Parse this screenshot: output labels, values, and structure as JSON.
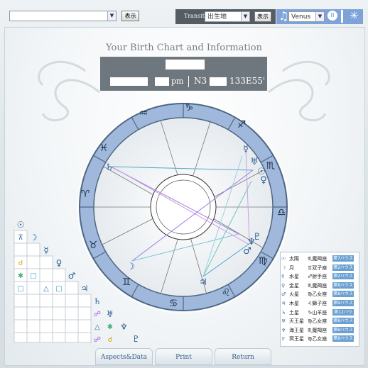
{
  "header": {
    "transit_label": "Transit",
    "transit_select": "出生地",
    "display_button": "表示",
    "display_button_2": "表示",
    "planet_select": "Venus"
  },
  "title": "Your Birth Chart and Information",
  "info": {
    "time_suffix": "pm",
    "coords": "N3",
    "longitude": "133E55'"
  },
  "colors": {
    "accent": "#7ea3d8",
    "header_dark": "#555d63",
    "info_box": "#6f777e",
    "house_tag": "#6aa0d2"
  },
  "planet_table": [
    {
      "symbol": "☉",
      "name": "太陽",
      "sign": "♏魔羯座",
      "house": "第7ハウス"
    },
    {
      "symbol": "☽",
      "name": "月",
      "sign": "♊双子座",
      "house": "第2ハウス"
    },
    {
      "symbol": "☿",
      "name": "水星",
      "sign": "♐射手座",
      "house": "第2ハウス"
    },
    {
      "symbol": "♀",
      "name": "金星",
      "sign": "♏魔羯座",
      "house": "第8ハウス"
    },
    {
      "symbol": "♂",
      "name": "火星",
      "sign": "♍乙女座",
      "house": "第8ハウス"
    },
    {
      "symbol": "♃",
      "name": "木星",
      "sign": "♌獅子座",
      "house": "第9ハウス"
    },
    {
      "symbol": "♄",
      "name": "土星",
      "sign": "♑山羊座",
      "house": "第12ハウス"
    },
    {
      "symbol": "♅",
      "name": "天王星",
      "sign": "♍乙女座",
      "house": "第8ハウス"
    },
    {
      "symbol": "♆",
      "name": "海王星",
      "sign": "♏魔羯座",
      "house": "第8ハウス"
    },
    {
      "symbol": "♇",
      "name": "冥王星",
      "sign": "♍乙女座",
      "house": "第8ハウス"
    }
  ],
  "tabs": {
    "aspects": "Aspects&Data",
    "print": "Print",
    "return": "Return"
  }
}
